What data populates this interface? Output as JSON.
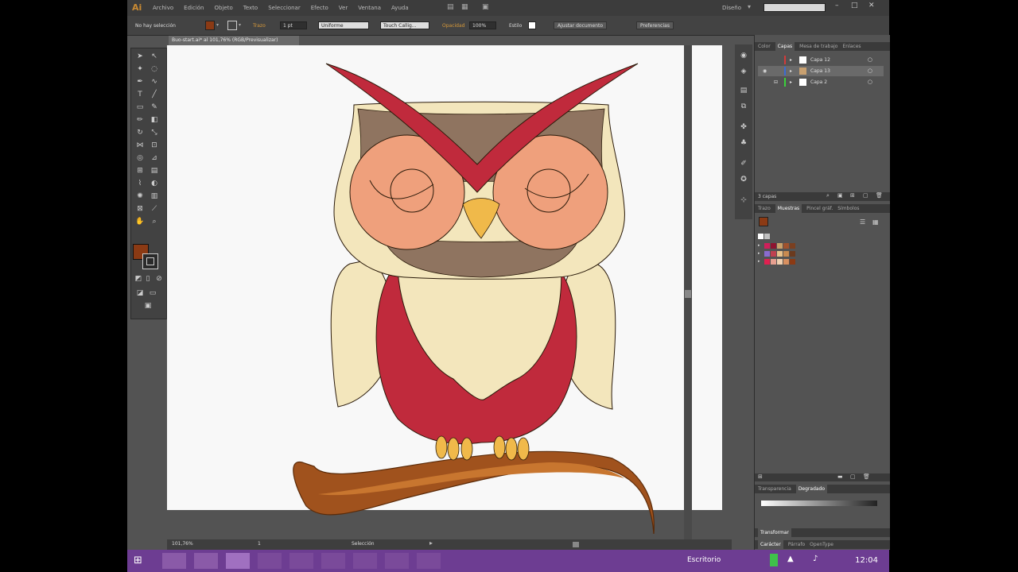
{
  "app": {
    "logo": "Ai",
    "menus": [
      "Archivo",
      "Edición",
      "Objeto",
      "Texto",
      "Seleccionar",
      "Efecto",
      "Ver",
      "Ventana",
      "Ayuda"
    ],
    "workspace": "Diseño",
    "search_placeholder": ""
  },
  "control": {
    "selection": "No hay selección",
    "trazo_label": "Trazo",
    "trazo_value": "1 pt",
    "stroke_profile": "Uniforme",
    "brush": "Touch Callig...",
    "opacity_label": "Opacidad",
    "opacity_value": "100%",
    "style_label": "Estilo",
    "doc_setup": "Ajustar documento",
    "preferences": "Preferencias"
  },
  "document": {
    "tab": "Buo-start.ai* al 101,76% (RGB/Previsualizar)"
  },
  "colors": {
    "fill": "#8b3a14",
    "accent": "#6d3d92"
  },
  "layers_panel": {
    "tabs": [
      "Color",
      "Capas",
      "Mesa de trabajo",
      "Enlaces"
    ],
    "active_tab": "Capas",
    "layers": [
      {
        "name": "Capa 12",
        "color": "#d23b3b"
      },
      {
        "name": "Capa 13",
        "color": "#3b6bd2"
      },
      {
        "name": "Capa 2",
        "color": "#3bd23b"
      }
    ],
    "footer": "3 capas"
  },
  "swatches_panel": {
    "tabs": [
      "Trazo",
      "Muestras",
      "Pincel gráf.",
      "Símbolos"
    ],
    "active_tab": "Muestras",
    "rows": [
      [
        "#ffffff",
        "#c0c0c0"
      ],
      [
        "#d01f5a",
        "#8e1430",
        "#c9a06a",
        "#a0522d",
        "#7a3f20"
      ],
      [
        "#8a6bd0",
        "#c04050",
        "#e8c08a",
        "#c88a50",
        "#6b3a1e"
      ],
      [
        "#e02050",
        "#e8a090",
        "#f0d0b0",
        "#d89060",
        "#8b3a14"
      ]
    ]
  },
  "gradient_panel": {
    "tabs": [
      "Transparencia",
      "Degradado"
    ],
    "active_tab": "Degradado"
  },
  "bottom_panels": {
    "transform": "Transformar",
    "tabs": [
      "Carácter",
      "Párrafo",
      "OpenType"
    ]
  },
  "status": {
    "zoom": "101,76%",
    "page": "1",
    "mode": "Selección"
  },
  "taskbar": {
    "desktop": "Escritorio",
    "time": "12:04"
  }
}
